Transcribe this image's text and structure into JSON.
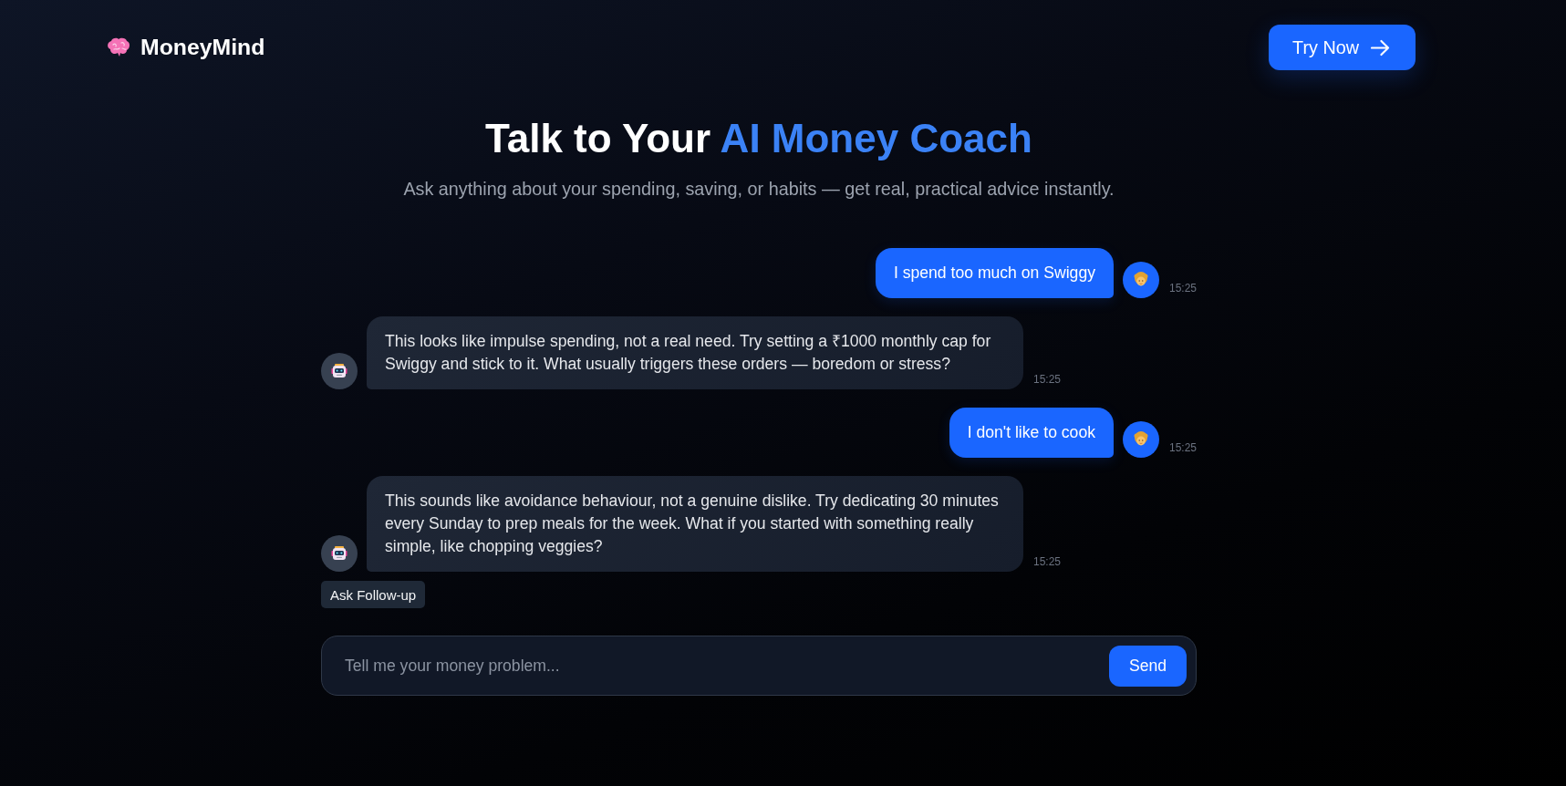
{
  "header": {
    "brand": "MoneyMind",
    "cta": "Try Now"
  },
  "hero": {
    "title": "Talk to Your",
    "highlight": "AI Money Coach",
    "subtitle": "Ask anything about your spending, saving, or habits — get real, practical advice instantly."
  },
  "chat": {
    "messages": [
      {
        "kind": "user",
        "text": "I spend too much on Swiggy",
        "time": "15:25"
      },
      {
        "kind": "bot",
        "text": "This looks like impulse spending, not a real need. Try setting a ₹1000 monthly cap for Swiggy and stick to it. What usually triggers these orders — boredom or stress?",
        "time": "15:25"
      },
      {
        "kind": "user",
        "text": "I don't like to cook",
        "time": "15:25"
      },
      {
        "kind": "bot",
        "text": "This sounds like avoidance behaviour, not a genuine dislike. Try dedicating 30 minutes every Sunday to prep meals for the week. What if you started with something really simple, like chopping veggies?",
        "time": "15:25"
      }
    ],
    "follow_up": "Ask Follow-up"
  },
  "composer": {
    "placeholder": "Tell me your money problem...",
    "button": "Send"
  }
}
